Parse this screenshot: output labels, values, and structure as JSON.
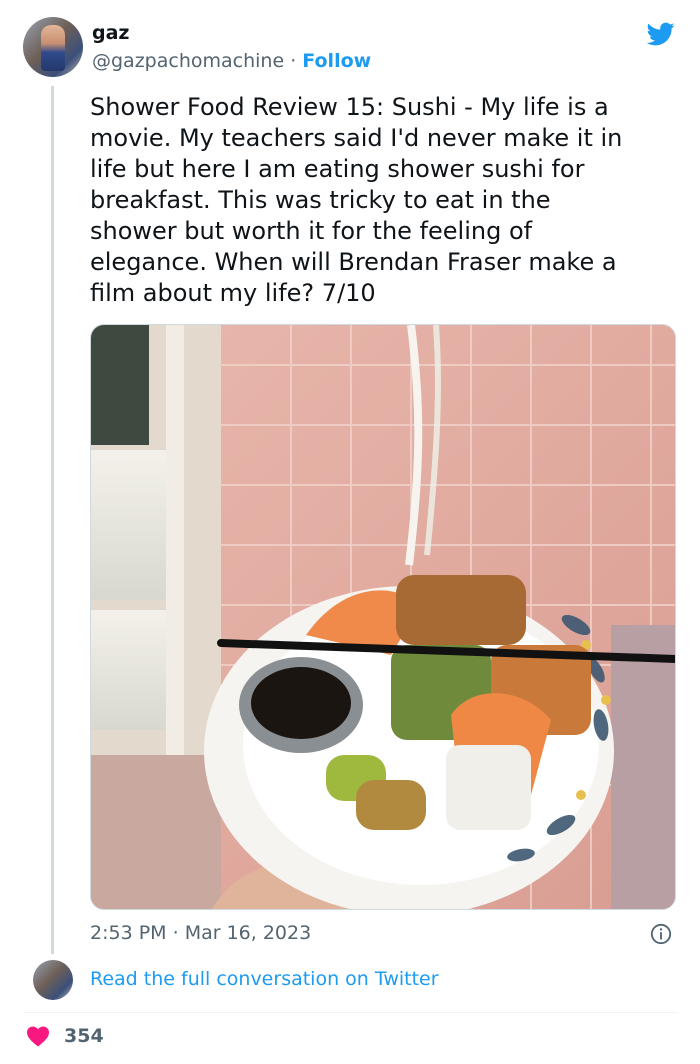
{
  "author": {
    "name": "gaz",
    "handle": "@gazpachomachine",
    "separator": "·",
    "follow_label": "Follow"
  },
  "tweet": {
    "text": "Shower Food Review 15: Sushi - My life is a\nmovie. My teachers said I'd never make it in\nlife but here I am eating shower sushi for\nbreakfast. This was tricky to eat in the\nshower but worth it for the feeling of\nelegance. When will Brendan Fraser make a\nfilm about my life? 7/10"
  },
  "meta": {
    "time": "2:53 PM",
    "separator": "·",
    "date": "Mar 16, 2023"
  },
  "conversation": {
    "link_label": "Read the full conversation on Twitter"
  },
  "engagement": {
    "likes": "354"
  },
  "icons": {
    "platform": "twitter-bird-icon",
    "info": "info-icon",
    "like": "heart-icon"
  },
  "colors": {
    "accent": "#1d9bf0",
    "heart": "#f91880",
    "muted": "#536471"
  }
}
